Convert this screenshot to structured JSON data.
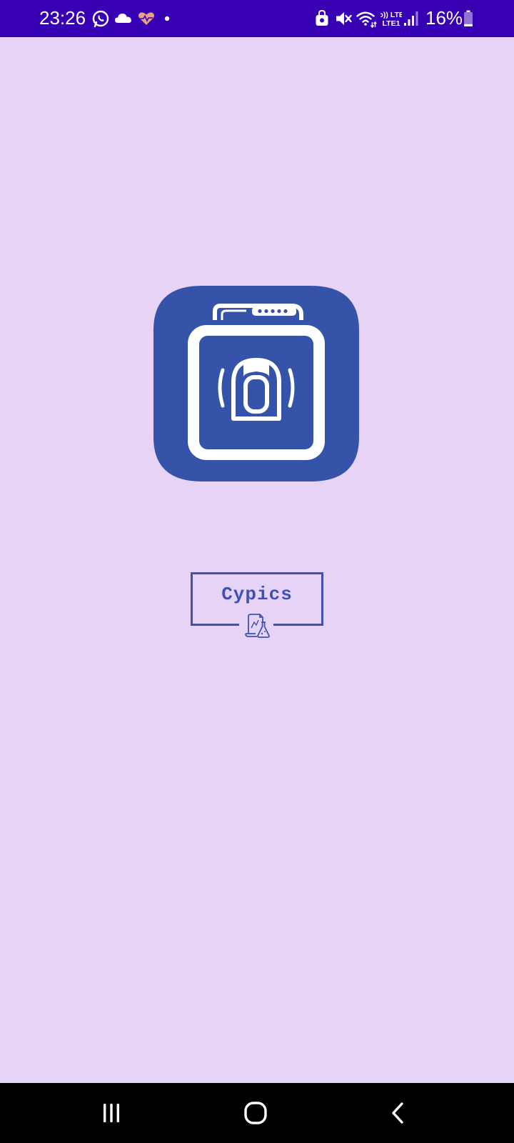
{
  "status_bar": {
    "time": "23:26",
    "battery_text": "16%",
    "network_label": "Vo)) LTE1"
  },
  "brand": {
    "name": "Cypics"
  },
  "colors": {
    "status_bar_bg": "#3700b3",
    "background": "#e6d3f6",
    "brand_blue": "#3f51b5",
    "logo_blue": "#3553a8",
    "nav_bar_bg": "#000000"
  },
  "icons": {
    "status_left": [
      "whatsapp-icon",
      "cloud-icon",
      "heart-rate-icon",
      "notification-dot-icon"
    ],
    "status_right": [
      "secure-folder-icon",
      "mute-icon",
      "wifi-icon",
      "volte-lte-icon",
      "signal-icon",
      "battery-icon"
    ],
    "logo": "app-logo-icon",
    "brand_badge": "lab-flask-icon",
    "navigation": [
      "recents-icon",
      "home-icon",
      "back-icon"
    ]
  }
}
